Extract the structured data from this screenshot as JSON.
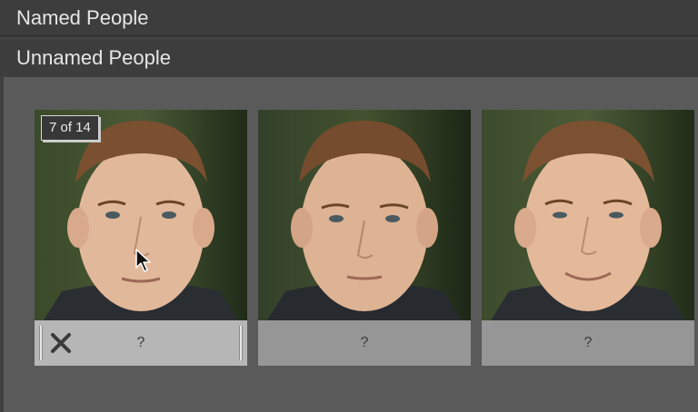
{
  "sections": {
    "named_label": "Named People",
    "unnamed_label": "Unnamed People"
  },
  "cluster": {
    "count_badge": "7 of 14"
  },
  "faces": [
    {
      "label": "?"
    },
    {
      "label": "?"
    },
    {
      "label": "?"
    }
  ],
  "colors": {
    "background": "#3f3f3f",
    "grid_panel": "#5a5a5a",
    "label_bar": "#969696",
    "label_bar_selected": "#b6b6b6"
  }
}
